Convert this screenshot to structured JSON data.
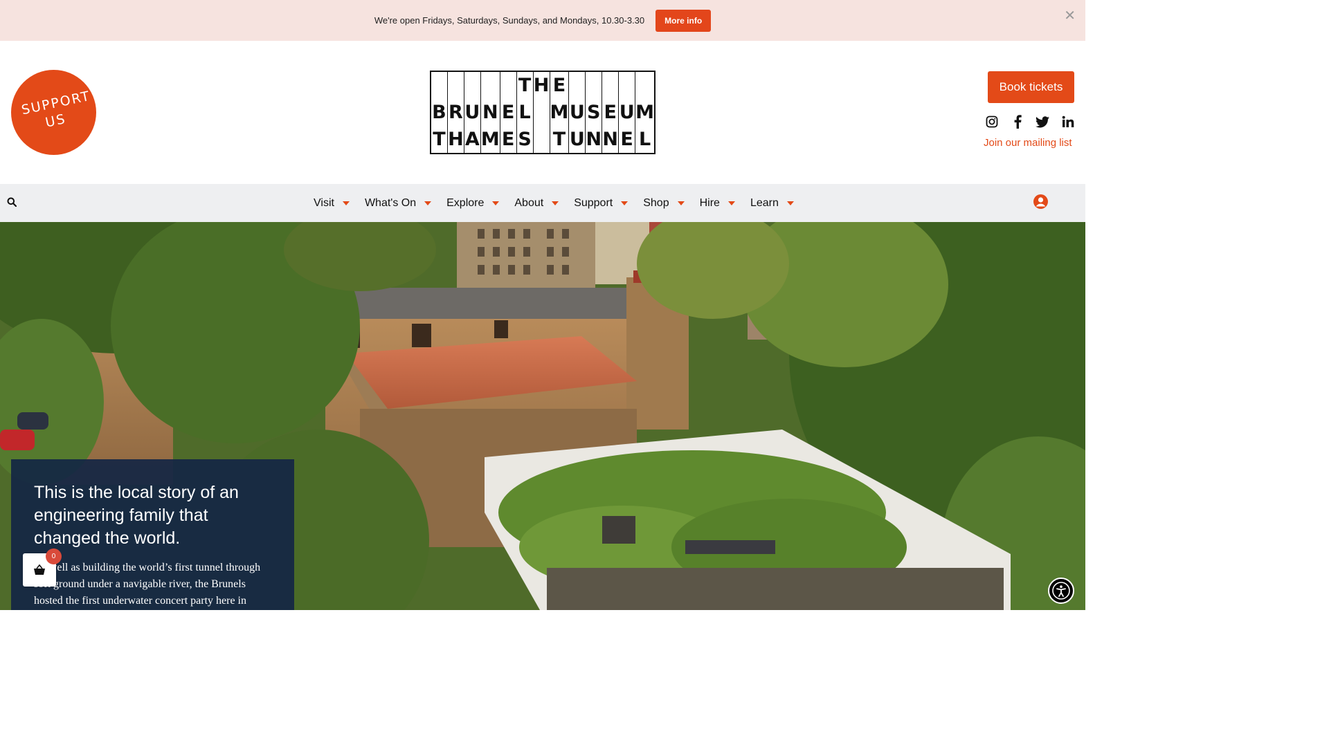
{
  "announcement": {
    "text": "We're open Fridays, Saturdays, Sundays, and Mondays, 10.30-3.30",
    "button": "More info",
    "close": "✕"
  },
  "header": {
    "support_badge": "SUPPORT US",
    "logo": {
      "rows": [
        [
          "",
          "",
          "",
          "",
          "",
          "T",
          "H",
          "E",
          "",
          "",
          "",
          "",
          ""
        ],
        [
          "B",
          "R",
          "U",
          "N",
          "E",
          "L",
          "",
          "M",
          "U",
          "S",
          "E",
          "U",
          "M"
        ],
        [
          "T",
          "H",
          "A",
          "M",
          "E",
          "S",
          "",
          "T",
          "U",
          "N",
          "N",
          "E",
          "L"
        ]
      ]
    },
    "book_tickets": "Book tickets",
    "socials": [
      {
        "icon": "instagram-icon",
        "glyph": "◎"
      },
      {
        "icon": "facebook-icon",
        "glyph": "f"
      },
      {
        "icon": "twitter-icon",
        "glyph": "🐦"
      },
      {
        "icon": "linkedin-icon",
        "glyph": "in"
      }
    ],
    "mailing_list": "Join our mailing list"
  },
  "nav": {
    "items": [
      "Visit",
      "What's On",
      "Explore",
      "About",
      "Support",
      "Shop",
      "Hire",
      "Learn"
    ]
  },
  "hero": {
    "title": "This is the local story of an engineering family that changed the world.",
    "body": "As well as building the world’s first tunnel through soft ground under a navigable river, the Brunels hosted the first underwater concert party here in"
  },
  "basket": {
    "count": "0"
  },
  "colors": {
    "accent": "#e34a18",
    "announce_bg": "#f6e3df",
    "nav_bg": "#eeeff1",
    "panel_bg": "#142644"
  }
}
